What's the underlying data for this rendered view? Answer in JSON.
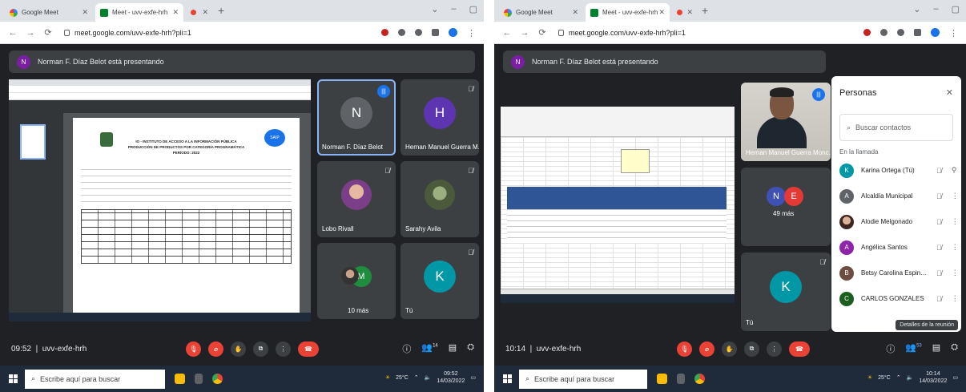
{
  "left": {
    "tabs": [
      {
        "label": "Google Meet"
      },
      {
        "label": "Meet - uvv-exfe-hrh"
      },
      {
        "label": ""
      }
    ],
    "url": "meet.google.com/uvv-exfe-hrh?pli=1",
    "presenting": "Norman F. Díaz Belot está presentando",
    "tiles": [
      {
        "name": "Norman F. Díaz Belot",
        "initial": "N",
        "color": "#5f6368"
      },
      {
        "name": "Hernan Manuel Guerra M...",
        "initial": "H",
        "color": "#5e35b1"
      },
      {
        "name": "Lobo Rivall"
      },
      {
        "name": "Sarahy Avila"
      },
      {
        "name": "10 más",
        "initial": "M",
        "color": "#1e8e3e"
      },
      {
        "name": "Tú",
        "initial": "K",
        "color": "#0097a7"
      }
    ],
    "doc": {
      "title_lines": [
        "IO - INSTITUTO DE ACCESO A LA INFORMACIÓN PÚBLICA",
        "PRODUCCIÓN DE PRODUCTOS POR CATEGORÍA PROGRAMÁTICA",
        "PERÍODO: 2022"
      ],
      "logo": "SAIP"
    },
    "meeting_time": "09:52",
    "meeting_code": "uvv-exfe-hrh",
    "participant_count": "14",
    "taskbar_search": "Escribe aquí para buscar",
    "tray_temp": "25°C",
    "tray_time": "09:52",
    "tray_date": "14/03/2022"
  },
  "right": {
    "tabs": [
      {
        "label": "Google Meet"
      },
      {
        "label": "Meet - uvv-exfe-hrh"
      },
      {
        "label": ""
      }
    ],
    "url": "meet.google.com/uvv-exfe-hrh?pli=1",
    "presenting": "Norman F. Díaz Belot está presentando",
    "tiles": [
      {
        "name": "Hernan Manuel Guerra Monc..."
      },
      {
        "name": "49 más",
        "initial_a": "N",
        "initial_b": "E",
        "color_a": "#3f51b5",
        "color_b": "#e53935"
      },
      {
        "name": "Tú",
        "initial": "K",
        "color": "#0097a7"
      }
    ],
    "people": {
      "title": "Personas",
      "search_placeholder": "Buscar contactos",
      "section": "En la llamada",
      "rows": [
        {
          "name": "Karina Ortega (Tú)",
          "initial": "K",
          "color": "#0097a7"
        },
        {
          "name": "Alcaldía Municipal",
          "initial": "A",
          "color": "#5f6368"
        },
        {
          "name": "Alodie Melgonado",
          "initial": "",
          "color": "#6d4c41"
        },
        {
          "name": "Angélica Santos",
          "initial": "A",
          "color": "#8e24aa"
        },
        {
          "name": "Betsy Carolina Espinoza...",
          "initial": "B",
          "color": "#6d4c41"
        },
        {
          "name": "CARLOS GONZALES",
          "initial": "C",
          "color": "#1b5e20"
        }
      ]
    },
    "tooltip": "Detalles de la reunión",
    "meeting_time": "10:14",
    "meeting_code": "uvv-exfe-hrh",
    "participant_count": "53",
    "taskbar_search": "Escribe aquí para buscar",
    "tray_temp": "25°C",
    "tray_time": "10:14",
    "tray_date": "14/03/2022"
  },
  "colors": {
    "meet_bg": "#202124",
    "tile_bg": "#3c4043",
    "end_call": "#ea4335",
    "accent": "#1a73e8",
    "taskbar": "#1f2b3a"
  }
}
